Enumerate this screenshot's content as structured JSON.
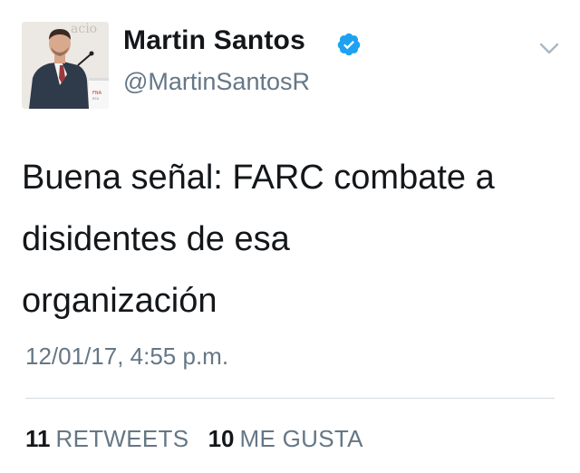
{
  "user": {
    "display_name": "Martin Santos",
    "handle": "@MartinSantosR",
    "verified": true,
    "avatar_icon": "profile-photo-speaker-at-podium"
  },
  "tweet": {
    "lines": [
      "Buena señal: FARC combate a",
      "disidentes de esa",
      "organización"
    ],
    "timestamp": "12/01/17, 4:55 p.m."
  },
  "stats": {
    "retweets_count": "11",
    "retweets_label": "RETWEETS",
    "likes_count": "10",
    "likes_label": "ME GUSTA"
  },
  "icons": {
    "verified": "verified-badge-icon",
    "menu": "chevron-down-icon"
  },
  "colors": {
    "text_primary": "#14171a",
    "text_secondary": "#657786",
    "verified_blue": "#1da1f2",
    "divider": "#d5dbe0",
    "background": "#ffffff"
  }
}
